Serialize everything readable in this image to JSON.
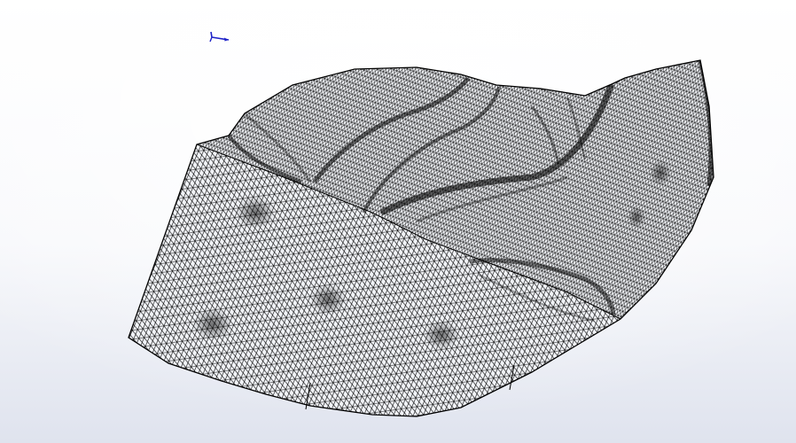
{
  "viewport": {
    "background_top": "#ffffff",
    "background_bottom": "#dfe3ee",
    "mesh_color": "#000000",
    "mesh_fill": "#f2f4f8",
    "shade_color": "#2a2a2a"
  },
  "triad": {
    "icon": "coordinate-triad-icon",
    "axis_color": "#1e22c8"
  },
  "model": {
    "display_mode": "wireframe-mesh",
    "icon": "leaf-shaped-part"
  }
}
